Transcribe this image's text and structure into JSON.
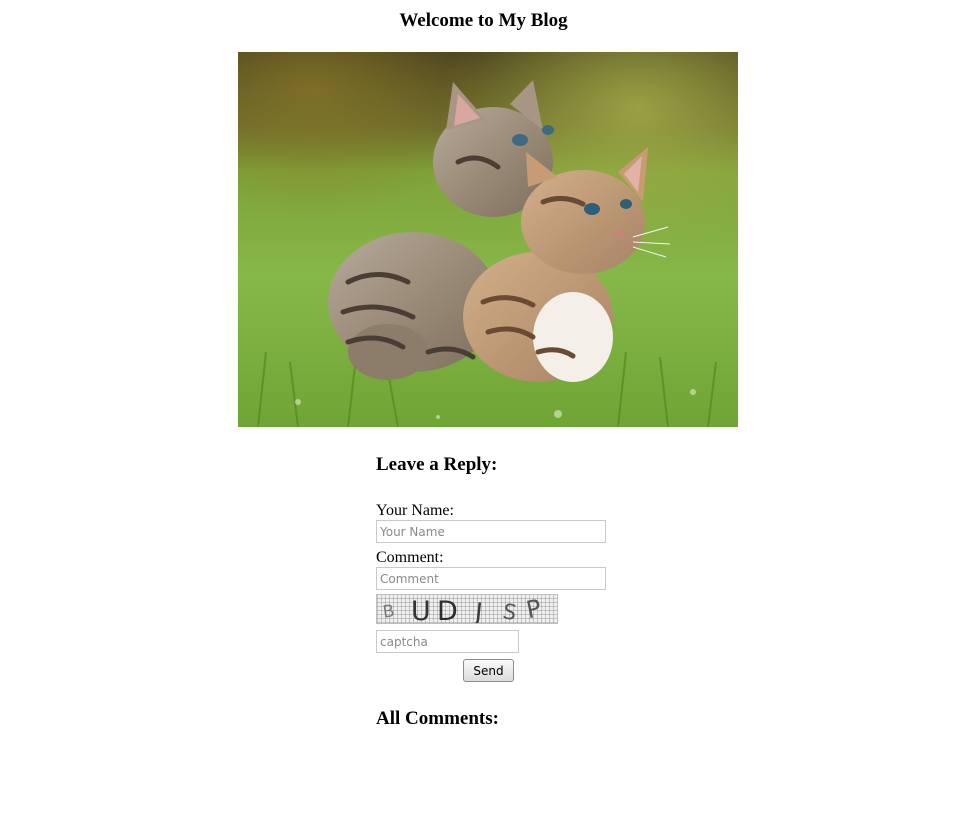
{
  "page": {
    "title": "Welcome to My Blog"
  },
  "hero_image": {
    "alt": "Two tabby kittens on grass"
  },
  "reply_form": {
    "heading": "Leave a Reply:",
    "name_label": "Your Name:",
    "name_placeholder": "Your Name",
    "name_value": "",
    "comment_label": "Comment:",
    "comment_placeholder": "Comment",
    "comment_value": "",
    "captcha_text": "BUDJSP",
    "captcha_placeholder": "captcha",
    "captcha_value": "",
    "send_label": "Send"
  },
  "comments": {
    "heading": "All Comments:",
    "items": []
  }
}
